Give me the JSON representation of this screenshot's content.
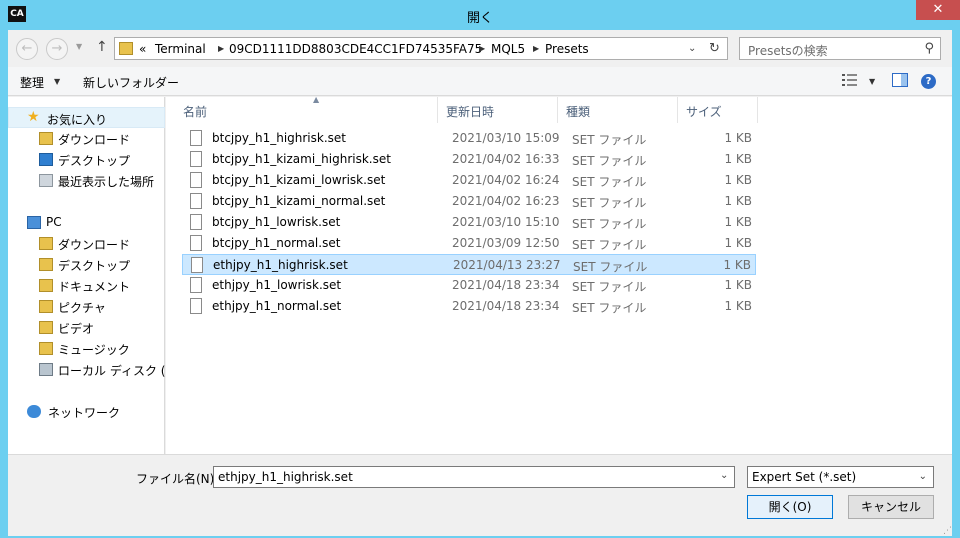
{
  "window": {
    "title": "開く",
    "app_icon_text": "CA",
    "close_glyph": "✕"
  },
  "address": {
    "overflow": "«",
    "crumbs": [
      "Terminal",
      "09CD1111DD8803CDE4CC1FD74535FA75",
      "MQL5",
      "Presets"
    ]
  },
  "search": {
    "placeholder": "Presetsの検索"
  },
  "toolbar": {
    "organize": "整理",
    "new_folder": "新しいフォルダー"
  },
  "nav": {
    "favorites": "お気に入り",
    "downloads": "ダウンロード",
    "desktop": "デスクトップ",
    "recent": "最近表示した場所",
    "pc": "PC",
    "pc_downloads": "ダウンロード",
    "pc_desktop": "デスクトップ",
    "documents": "ドキュメント",
    "pictures": "ピクチャ",
    "videos": "ビデオ",
    "music": "ミュージック",
    "local_disk": "ローカル ディスク (C:)",
    "network": "ネットワーク"
  },
  "columns": {
    "name": "名前",
    "date": "更新日時",
    "type": "種類",
    "size": "サイズ"
  },
  "files": [
    {
      "name": "btcjpy_h1_highrisk.set",
      "date": "2021/03/10 15:09",
      "type": "SET ファイル",
      "size": "1 KB"
    },
    {
      "name": "btcjpy_h1_kizami_highrisk.set",
      "date": "2021/04/02 16:33",
      "type": "SET ファイル",
      "size": "1 KB"
    },
    {
      "name": "btcjpy_h1_kizami_lowrisk.set",
      "date": "2021/04/02 16:24",
      "type": "SET ファイル",
      "size": "1 KB"
    },
    {
      "name": "btcjpy_h1_kizami_normal.set",
      "date": "2021/04/02 16:23",
      "type": "SET ファイル",
      "size": "1 KB"
    },
    {
      "name": "btcjpy_h1_lowrisk.set",
      "date": "2021/03/10 15:10",
      "type": "SET ファイル",
      "size": "1 KB"
    },
    {
      "name": "btcjpy_h1_normal.set",
      "date": "2021/03/09 12:50",
      "type": "SET ファイル",
      "size": "1 KB"
    },
    {
      "name": "ethjpy_h1_highrisk.set",
      "date": "2021/04/13 23:27",
      "type": "SET ファイル",
      "size": "1 KB"
    },
    {
      "name": "ethjpy_h1_lowrisk.set",
      "date": "2021/04/18 23:34",
      "type": "SET ファイル",
      "size": "1 KB"
    },
    {
      "name": "ethjpy_h1_normal.set",
      "date": "2021/04/18 23:34",
      "type": "SET ファイル",
      "size": "1 KB"
    }
  ],
  "selected_index": 6,
  "bottom": {
    "filename_label": "ファイル名(N):",
    "filename_value": "ethjpy_h1_highrisk.set",
    "filter": "Expert Set (*.set)",
    "open": "開く(O)",
    "cancel": "キャンセル"
  },
  "colors": {
    "accent": "#0078d7",
    "selection": "#cce8ff",
    "frame": "#6ccff0",
    "close": "#c74f4f"
  }
}
